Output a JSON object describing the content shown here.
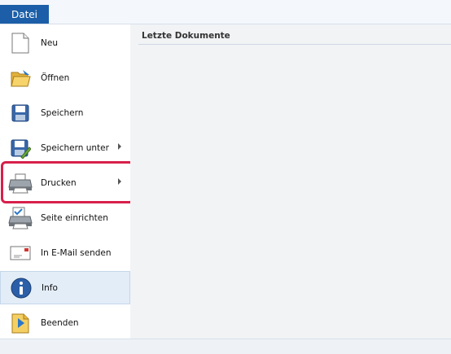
{
  "tab": {
    "label": "Datei"
  },
  "menu": {
    "items": [
      {
        "label": "Neu",
        "icon": "new-document-icon"
      },
      {
        "label": "Öffnen",
        "icon": "open-folder-icon"
      },
      {
        "label": "Speichern",
        "icon": "save-icon"
      },
      {
        "label": "Speichern unter",
        "icon": "save-as-icon",
        "submenu": true
      },
      {
        "label": "Drucken",
        "icon": "printer-icon",
        "submenu": true
      },
      {
        "label": "Seite einrichten",
        "icon": "page-setup-icon"
      },
      {
        "label": "In E-Mail senden",
        "icon": "email-icon"
      },
      {
        "label": "Info",
        "icon": "info-icon",
        "selected": true
      },
      {
        "label": "Beenden",
        "icon": "exit-icon"
      }
    ]
  },
  "recent": {
    "title": "Letzte Dokumente"
  },
  "colors": {
    "tab": "#1c5fa8",
    "highlight": "#d71f4a",
    "selected": "#e3edf7"
  }
}
